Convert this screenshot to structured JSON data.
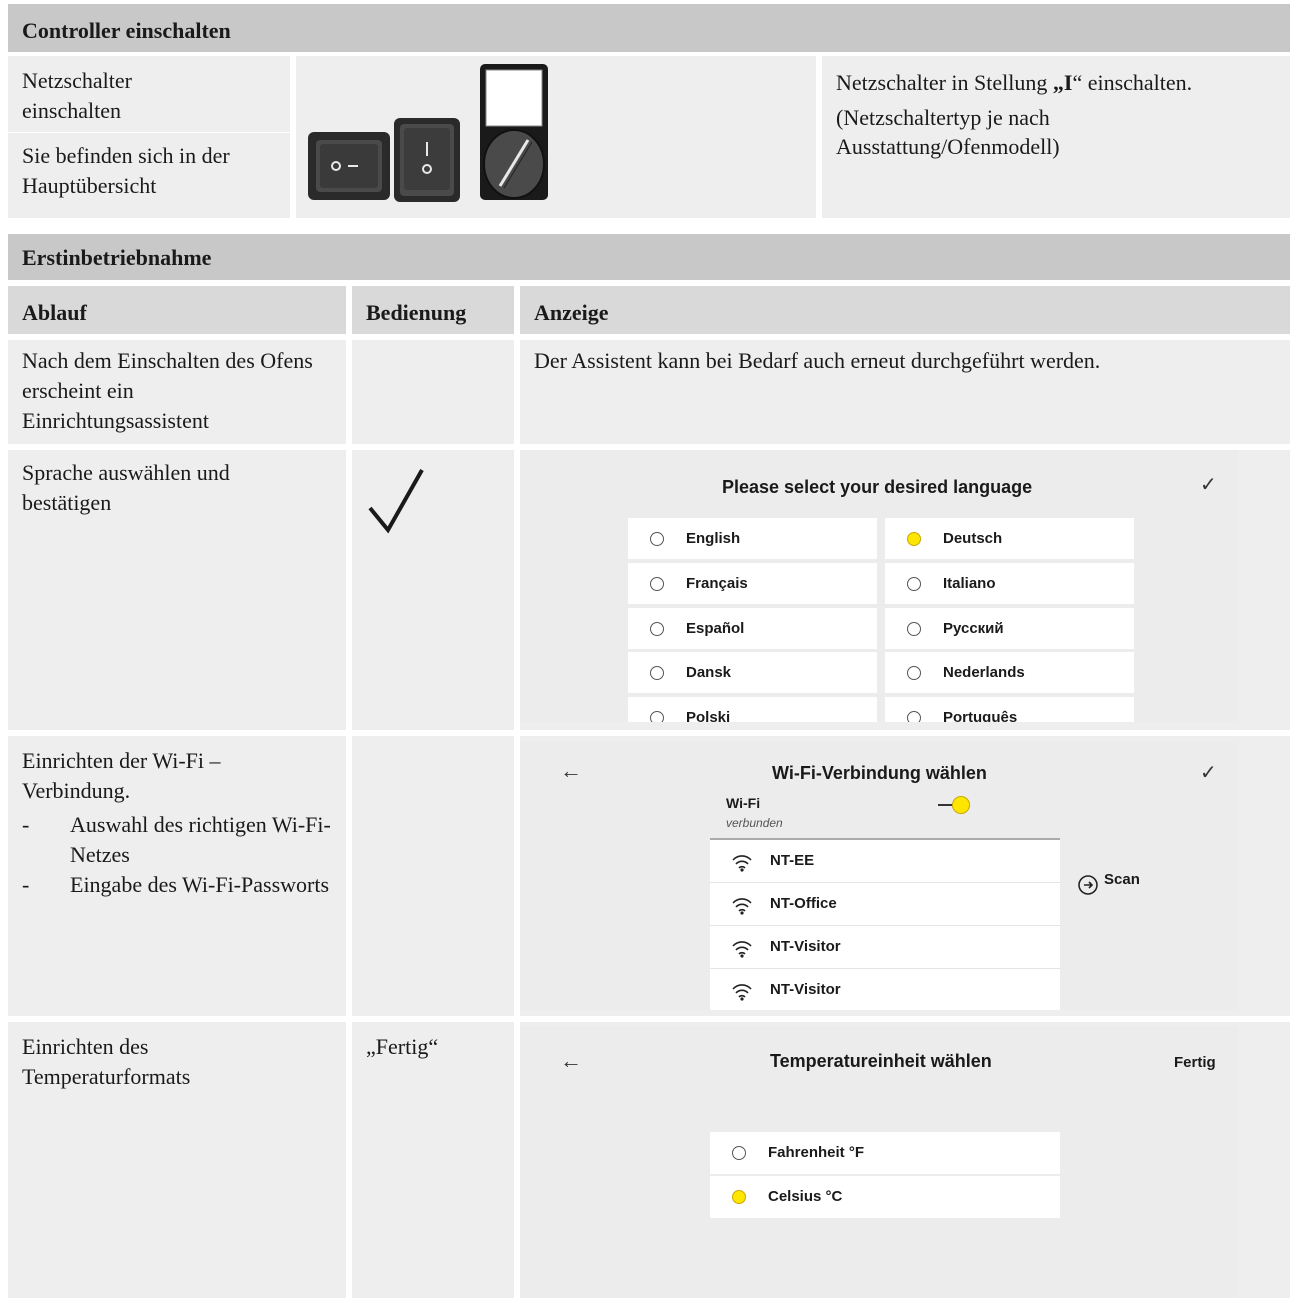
{
  "section1": {
    "title": "Controller einschalten",
    "step1": "Netzschalter einschalten",
    "step2": "Sie befinden sich in der Hauptübersicht",
    "desc_prefix": "Netzschalter in Stellung ",
    "desc_quote_open": "„",
    "desc_bold": "I",
    "desc_quote_close": "“",
    "desc_suffix": " einschalten.",
    "desc_note": "(Netzschaltertyp je nach Ausstattung/Ofenmodell)",
    "switch1_label": "o –",
    "switch2_label_top": "|",
    "switch2_label_bottom": "o"
  },
  "section2": {
    "title": "Erstinbetriebnahme",
    "col_ablauf": "Ablauf",
    "col_bedienung": "Bedienung",
    "col_anzeige": "Anzeige"
  },
  "rows": {
    "r1": {
      "ablauf": "Nach dem Einschalten des Ofens erscheint ein Einrichtungsassistent",
      "anzeige": "Der Assistent kann bei Bedarf auch erneut durchgeführt werden."
    },
    "r2": {
      "ablauf": "Sprache auswählen und bestätigen",
      "bedienung_icon": "checkmark-icon"
    },
    "r3": {
      "ablauf_intro": "Einrichten der Wi-Fi – Verbindung.",
      "bullet_dash": "-",
      "bullet1": "Auswahl des richtigen Wi-Fi-Netzes",
      "bullet2": "Eingabe des Wi-Fi-Passworts"
    },
    "r4": {
      "ablauf": "Einrichten des Temperaturformats",
      "bedienung": "„Fertig“"
    }
  },
  "lang_screen": {
    "title": "Please select your desired language",
    "confirm_symbol": "✓",
    "options": [
      {
        "label": "English",
        "selected": false
      },
      {
        "label": "Deutsch",
        "selected": true
      },
      {
        "label": "Français",
        "selected": false
      },
      {
        "label": "Italiano",
        "selected": false
      },
      {
        "label": "Español",
        "selected": false
      },
      {
        "label": "Русский",
        "selected": false
      },
      {
        "label": "Dansk",
        "selected": false
      },
      {
        "label": "Nederlands",
        "selected": false
      },
      {
        "label": "Polski",
        "selected": false
      },
      {
        "label": "Português",
        "selected": false
      }
    ]
  },
  "wifi_screen": {
    "back_symbol": "←",
    "title": "Wi-Fi-Verbindung wählen",
    "confirm_symbol": "✓",
    "wifi_label": "Wi-Fi",
    "status": "verbunden",
    "toggle_on": true,
    "scan_label": "Scan",
    "networks": [
      "NT-EE",
      "NT-Office",
      "NT-Visitor",
      "NT-Visitor"
    ]
  },
  "temp_screen": {
    "back_symbol": "←",
    "title": "Temperatureinheit wählen",
    "done_label": "Fertig",
    "options": [
      {
        "label": "Fahrenheit °F",
        "selected": false
      },
      {
        "label": "Celsius °C",
        "selected": true
      }
    ]
  },
  "colors": {
    "header_bg": "#c8c8c8",
    "cell_bg": "#eeeeee",
    "accent_yellow": "#ffe600"
  }
}
